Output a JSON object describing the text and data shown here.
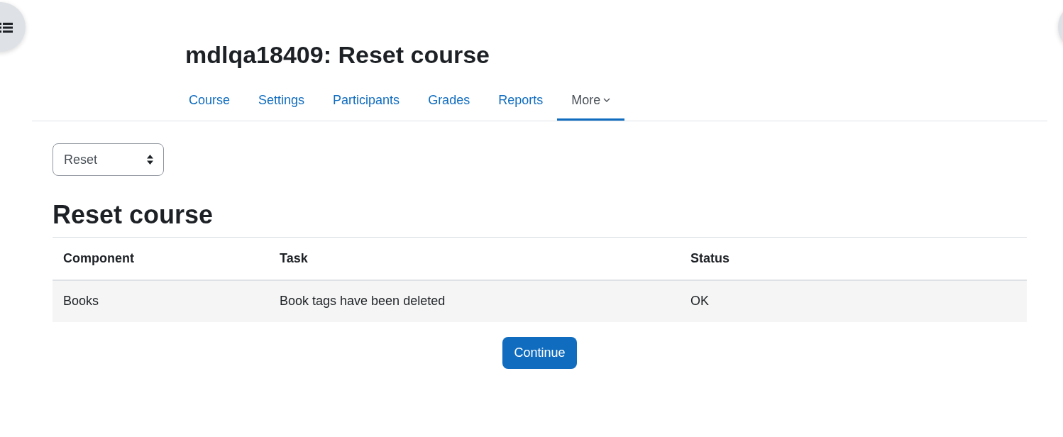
{
  "page_title": "mdlqa18409: Reset course",
  "nav_tabs": [
    {
      "label": "Course",
      "selected": false,
      "kind": "link"
    },
    {
      "label": "Settings",
      "selected": false,
      "kind": "link"
    },
    {
      "label": "Participants",
      "selected": false,
      "kind": "link"
    },
    {
      "label": "Grades",
      "selected": false,
      "kind": "link"
    },
    {
      "label": "Reports",
      "selected": false,
      "kind": "link"
    },
    {
      "label": "More",
      "selected": true,
      "kind": "dropdown"
    }
  ],
  "action_select": {
    "value": "Reset"
  },
  "heading": "Reset course",
  "table": {
    "columns": [
      "Component",
      "Task",
      "Status"
    ],
    "rows": [
      [
        "Books",
        "Book tags have been deleted",
        "OK"
      ]
    ]
  },
  "continue_button": "Continue"
}
